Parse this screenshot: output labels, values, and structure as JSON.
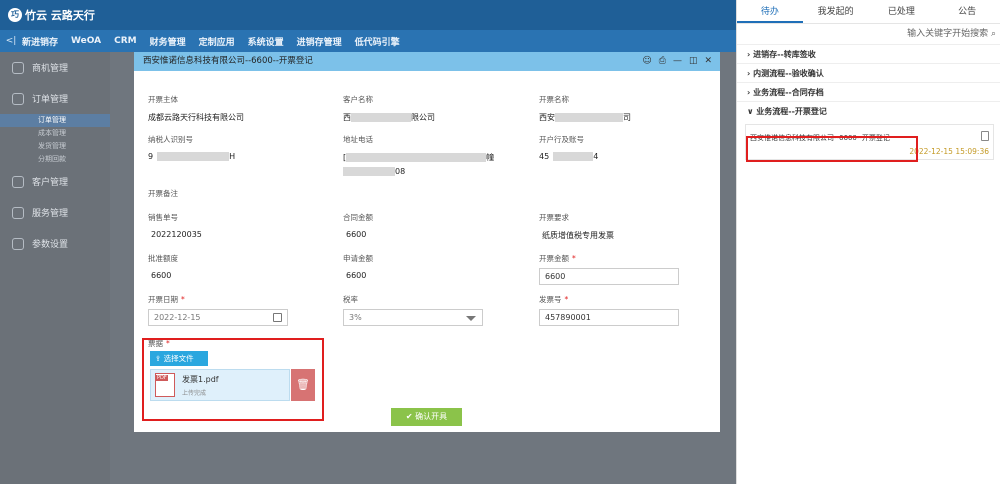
{
  "app": {
    "logo_mark": "巧",
    "logo_text": "竹云 云路天行"
  },
  "nav": {
    "back": "<|",
    "items": [
      "新进销存",
      "WeOA",
      "CRM",
      "财务管理",
      "定制应用",
      "系统设置",
      "进销存管理",
      "低代码引擎"
    ]
  },
  "sidebar": {
    "items": [
      "商机管理",
      "订单管理",
      "客户管理",
      "服务管理",
      "参数设置"
    ],
    "sub": [
      "订单管理",
      "成本管理",
      "发货管理",
      "分期回款"
    ]
  },
  "right": {
    "tabs": [
      "待办",
      "我发起的",
      "已处理",
      "公告"
    ],
    "search": "输入关键字开始搜索",
    "groups": [
      "进销存--转库签收",
      "内测流程--验收确认",
      "业务流程--合同存档",
      "业务流程--开票登记"
    ],
    "task": {
      "title": "西安惟诺信息科技有限公司--6600--开票登记",
      "date": "2022-12-15 15:09:36"
    }
  },
  "modal": {
    "title": "西安惟诺信息科技有限公司--6600--开票登记",
    "icons": [
      "☺",
      "⎙",
      "—",
      "◫",
      "✕"
    ],
    "fields": {
      "issuer_label": "开票主体",
      "issuer_value": "成都云路天行科技有限公司",
      "customer_label": "客户名称",
      "customer_value_a": "西",
      "customer_value_b": "限公司",
      "invoice_name_label": "开票名称",
      "invoice_name_value_a": "西安",
      "invoice_name_value_b": "司",
      "taxid_label": "纳税人识别号",
      "taxid_value_a": "9",
      "taxid_value_b": "H",
      "address_label": "地址电话",
      "address_value_a": "[",
      "address_value_b": "幢",
      "address_value_c": "08",
      "bank_label": "开户行及账号",
      "bank_value_a": "45",
      "bank_value_b": "4",
      "remark_label": "开票备注",
      "sales_no_label": "销售单号",
      "sales_no_value": "2022120035",
      "contract_amt_label": "合同金额",
      "contract_amt_value": "6600",
      "invoice_req_label": "开票要求",
      "invoice_req_value": "纸质增值税专用发票",
      "approved_label": "批准额度",
      "approved_value": "6600",
      "applied_label": "申请金额",
      "applied_value": "6600",
      "invoice_amt_label": "开票金额",
      "invoice_amt_value": "6600",
      "date_label": "开票日期",
      "date_value": "2022-12-15",
      "tax_label": "税率",
      "tax_value": "3%",
      "invoice_no_label": "发票号",
      "invoice_no_value": "457890001",
      "attach_label": "票据"
    },
    "upload_label": "选择文件",
    "file": {
      "type": "PDF",
      "name": "发票1.pdf",
      "status": "上传完成"
    },
    "confirm": "确认开具"
  }
}
